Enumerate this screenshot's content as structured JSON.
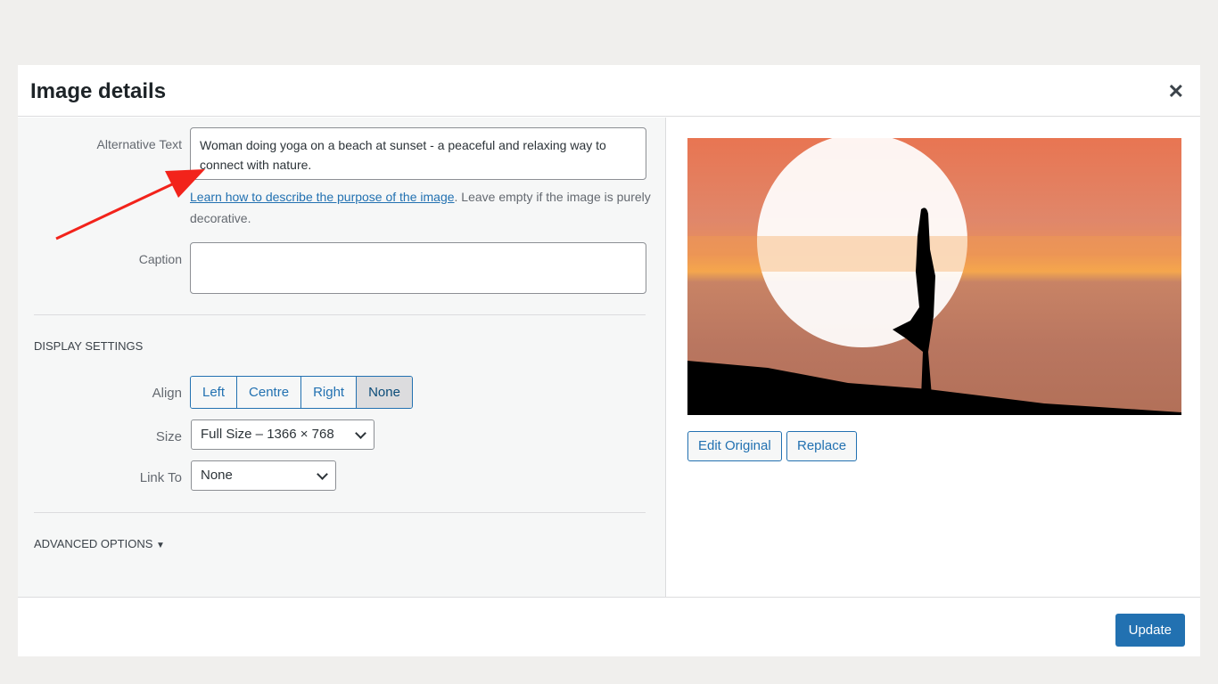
{
  "dialog": {
    "title": "Image details",
    "close_icon": "close-icon"
  },
  "form": {
    "alt_label": "Alternative Text",
    "alt_value": "Woman doing yoga on a beach at sunset - a peaceful and relaxing way to connect with nature.",
    "help_link": "Learn how to describe the purpose of the image",
    "help_text": ". Leave empty if the image is purely decorative.",
    "caption_label": "Caption",
    "caption_value": ""
  },
  "display": {
    "heading": "Display Settings",
    "align_label": "Align",
    "align_options": [
      "Left",
      "Centre",
      "Right",
      "None"
    ],
    "align_selected": "None",
    "size_label": "Size",
    "size_value": "Full Size – 1366 × 768",
    "link_label": "Link To",
    "link_value": "None"
  },
  "advanced": {
    "label": "Advanced Options",
    "icon": "triangle-down-icon"
  },
  "preview": {
    "edit_label": "Edit Original",
    "replace_label": "Replace"
  },
  "footer": {
    "update_label": "Update"
  },
  "colors": {
    "accent": "#2271b1",
    "arrow": "#f2231b"
  }
}
